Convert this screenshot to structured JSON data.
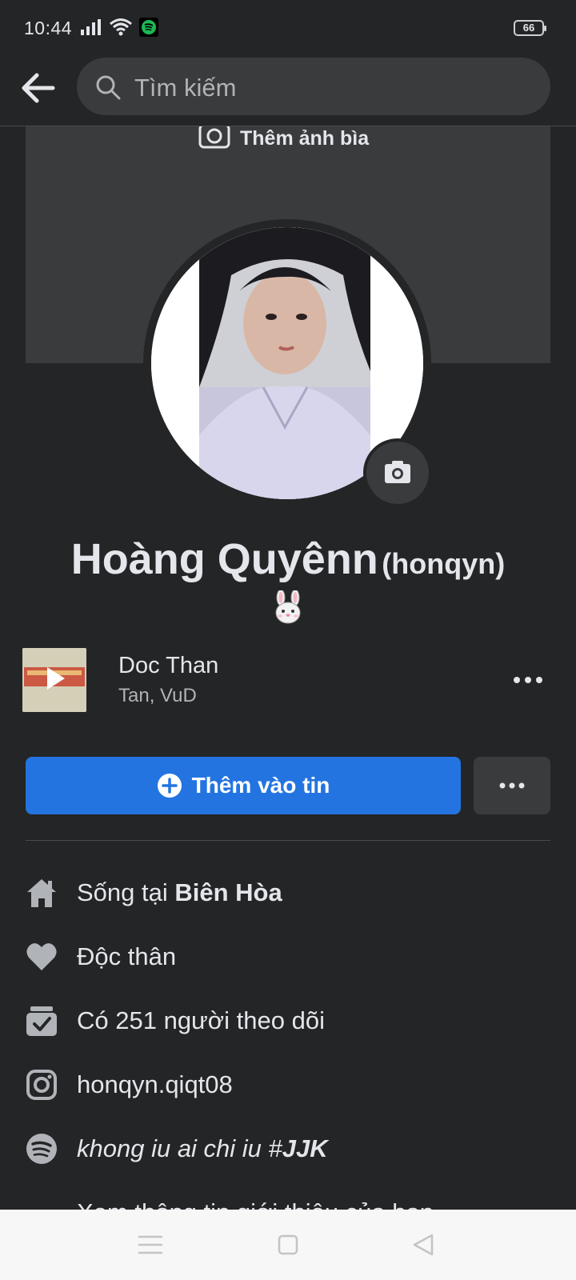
{
  "status_bar": {
    "time": "10:44",
    "battery": "66",
    "icons": [
      "signal-icon",
      "wifi-icon",
      "spotify-icon"
    ]
  },
  "header": {
    "search_placeholder": "Tìm kiếm"
  },
  "cover": {
    "add_cover_label": "Thêm ảnh bìa"
  },
  "profile": {
    "name": "Hoàng Quyênn",
    "username": "(honqyn)",
    "bio_emoji": "rabbit-face"
  },
  "music": {
    "title": "Doc Than",
    "artist": "Tan, VuD"
  },
  "actions": {
    "add_story_label": "Thêm vào tin"
  },
  "details": {
    "lives_prefix": "Sống tại ",
    "lives_city": "Biên Hòa",
    "relationship": "Độc thân",
    "followers": "Có 251 người theo dõi",
    "instagram": "honqyn.qiqt08",
    "spotify_prefix": "khong iu ai chi iu #",
    "spotify_tag": "JJK",
    "see_about": "Xem thông tin giới thiệu của bạn"
  },
  "colors": {
    "background": "#242526",
    "surface": "#3a3b3c",
    "primary": "#2374e1",
    "text": "#e4e6eb",
    "secondary_text": "#b0b3b8"
  }
}
